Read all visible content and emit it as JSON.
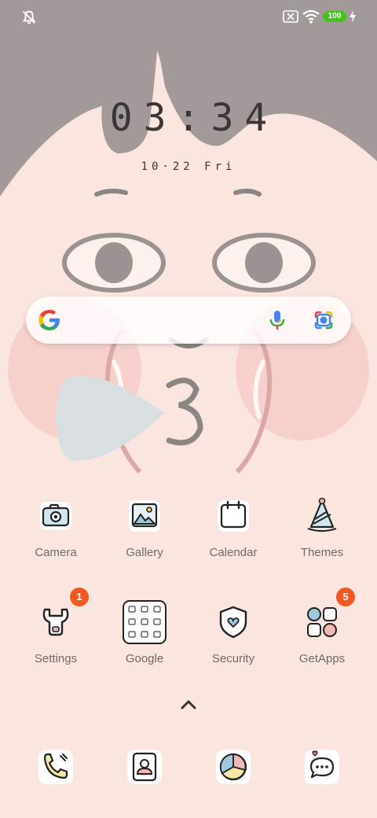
{
  "status_bar": {
    "battery_level": "100",
    "icons": [
      "alarm-off-icon",
      "no-sim-icon",
      "wifi-icon",
      "battery-icon",
      "charging-icon"
    ]
  },
  "lock": {
    "time": "03:34",
    "date": "10·22 Fri"
  },
  "search": {
    "icons": [
      "google-logo-icon",
      "microphone-icon",
      "google-lens-icon"
    ]
  },
  "apps_row1": [
    {
      "label": "Camera",
      "icon": "camera-icon"
    },
    {
      "label": "Gallery",
      "icon": "gallery-icon"
    },
    {
      "label": "Calendar",
      "icon": "calendar-icon"
    },
    {
      "label": "Themes",
      "icon": "themes-icon"
    }
  ],
  "apps_row2": [
    {
      "label": "Settings",
      "icon": "settings-icon",
      "badge": "1"
    },
    {
      "label": "Google",
      "icon": "google-folder-icon"
    },
    {
      "label": "Security",
      "icon": "security-icon"
    },
    {
      "label": "GetApps",
      "icon": "getapps-icon",
      "badge": "5"
    }
  ],
  "dock": [
    {
      "icon": "phone-icon"
    },
    {
      "icon": "contacts-icon"
    },
    {
      "icon": "browser-icon"
    },
    {
      "icon": "messages-icon"
    }
  ],
  "colors": {
    "background": "#fbe5df",
    "hair": "#a29a98",
    "badge": "#f4581e",
    "battery": "#46c21f",
    "label": "#6e6a6a"
  }
}
